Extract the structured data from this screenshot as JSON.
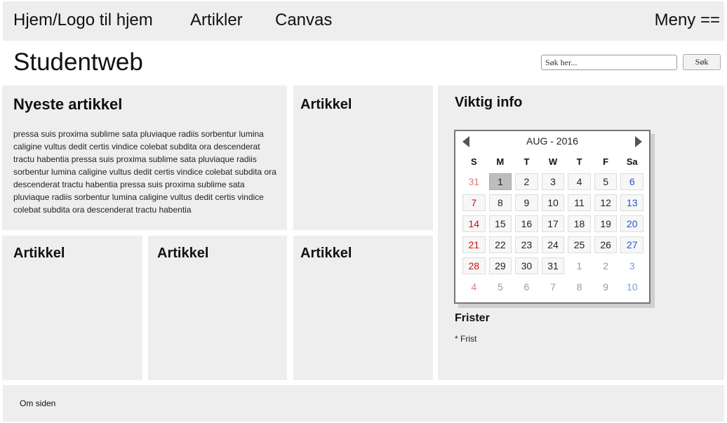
{
  "nav": {
    "home": "Hjem/Logo til hjem",
    "articles": "Artikler",
    "canvas": "Canvas",
    "menu": "Meny =="
  },
  "site_title": "Studentweb",
  "search": {
    "placeholder": "Søk her...",
    "button": "Søk"
  },
  "latest": {
    "title": "Nyeste artikkel",
    "body": "pressa suis proxima sublime sata pluviaque radiis sorbentur lumina caligine vultus dedit certis vindice colebat subdita ora descenderat tractu habentia pressa suis proxima sublime sata pluviaque radiis sorbentur lumina caligine vultus dedit certis vindice colebat subdita ora descenderat tractu habentia pressa suis proxima sublime sata pluviaque radiis sorbentur lumina caligine vultus dedit certis vindice colebat subdita ora descenderat tractu habentia"
  },
  "articles": [
    "Artikkel",
    "Artikkel",
    "Artikkel",
    "Artikkel"
  ],
  "info": {
    "title": "Viktig info",
    "calendar": {
      "month_label": "AUG - 2016",
      "weekdays": [
        "S",
        "M",
        "T",
        "W",
        "T",
        "F",
        "Sa"
      ],
      "days": [
        {
          "n": "31",
          "other": true
        },
        {
          "n": "1",
          "today": true
        },
        {
          "n": "2"
        },
        {
          "n": "3"
        },
        {
          "n": "4"
        },
        {
          "n": "5"
        },
        {
          "n": "6"
        },
        {
          "n": "7"
        },
        {
          "n": "8"
        },
        {
          "n": "9"
        },
        {
          "n": "10"
        },
        {
          "n": "11"
        },
        {
          "n": "12"
        },
        {
          "n": "13"
        },
        {
          "n": "14"
        },
        {
          "n": "15"
        },
        {
          "n": "16"
        },
        {
          "n": "17"
        },
        {
          "n": "18"
        },
        {
          "n": "19"
        },
        {
          "n": "20"
        },
        {
          "n": "21"
        },
        {
          "n": "22"
        },
        {
          "n": "23"
        },
        {
          "n": "24"
        },
        {
          "n": "25"
        },
        {
          "n": "26"
        },
        {
          "n": "27"
        },
        {
          "n": "28"
        },
        {
          "n": "29"
        },
        {
          "n": "30"
        },
        {
          "n": "31"
        },
        {
          "n": "1",
          "other": true
        },
        {
          "n": "2",
          "other": true
        },
        {
          "n": "3",
          "other": true
        },
        {
          "n": "4",
          "other": true
        },
        {
          "n": "5",
          "other": true
        },
        {
          "n": "6",
          "other": true
        },
        {
          "n": "7",
          "other": true
        },
        {
          "n": "8",
          "other": true
        },
        {
          "n": "9",
          "other": true
        },
        {
          "n": "10",
          "other": true
        }
      ],
      "prev_icon": "chevron-left-icon",
      "next_icon": "chevron-right-icon"
    },
    "deadlines_title": "Frister",
    "deadlines": [
      "* Frist"
    ]
  },
  "footer": {
    "about": "Om siden"
  },
  "colors": {
    "panel": "#eeeeee",
    "sunday": "#cc1111",
    "saturday": "#2255cc",
    "today": "#bdbdbd"
  }
}
